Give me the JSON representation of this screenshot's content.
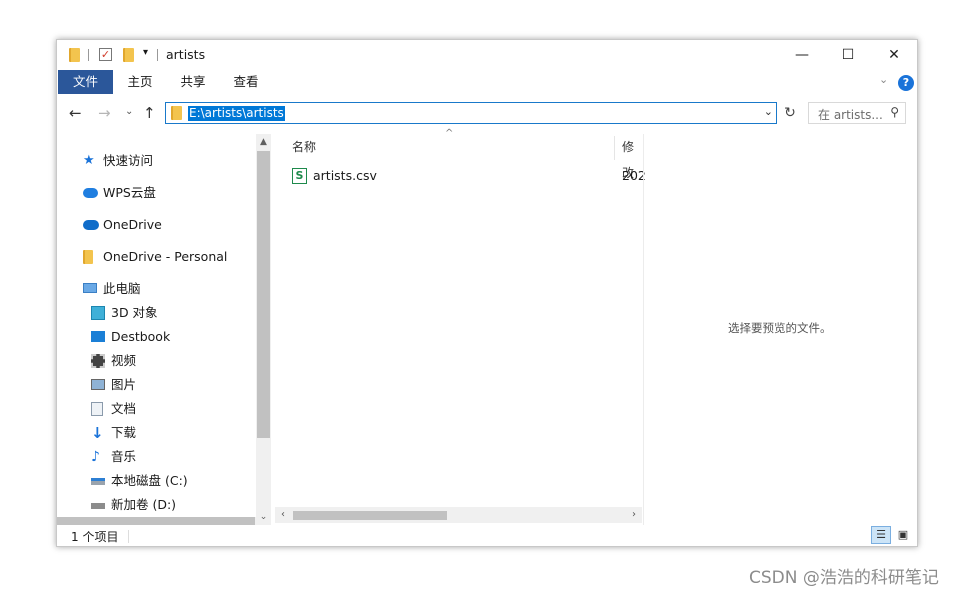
{
  "window": {
    "title": "artists",
    "controls": {
      "minimize": "—",
      "maximize": "☐",
      "close": "✕"
    }
  },
  "ribbon": {
    "tabs": [
      "文件",
      "主页",
      "共享",
      "查看"
    ],
    "help": "?"
  },
  "address": {
    "path": "E:\\artists\\artists",
    "search_placeholder": "在 artists..."
  },
  "navigation": {
    "items": [
      {
        "label": "快速访问",
        "icon": "star-icon",
        "indent": 0
      },
      {
        "label": "WPS云盘",
        "icon": "wps-cloud-icon",
        "indent": 0
      },
      {
        "label": "OneDrive",
        "icon": "onedrive-cloud-icon",
        "indent": 0
      },
      {
        "label": "OneDrive - Personal",
        "icon": "folder-icon",
        "indent": 0
      },
      {
        "label": "此电脑",
        "icon": "computer-icon",
        "indent": 0
      },
      {
        "label": "3D 对象",
        "icon": "3d-objects-icon",
        "indent": 1
      },
      {
        "label": "Destbook",
        "icon": "desktop-icon",
        "indent": 1
      },
      {
        "label": "视频",
        "icon": "video-icon",
        "indent": 1
      },
      {
        "label": "图片",
        "icon": "pictures-icon",
        "indent": 1
      },
      {
        "label": "文档",
        "icon": "documents-icon",
        "indent": 1
      },
      {
        "label": "下载",
        "icon": "download-icon",
        "indent": 1
      },
      {
        "label": "音乐",
        "icon": "music-icon",
        "indent": 1
      },
      {
        "label": "本地磁盘 (C:)",
        "icon": "local-disk-icon",
        "indent": 1
      },
      {
        "label": "新加卷 (D:)",
        "icon": "drive-icon",
        "indent": 1
      }
    ]
  },
  "files": {
    "columns": [
      "名称",
      "修改"
    ],
    "rows": [
      {
        "name": "artists.csv",
        "modified": "202",
        "icon": "wps-spreadsheet-icon"
      }
    ]
  },
  "preview": {
    "message": "选择要预览的文件。"
  },
  "status": {
    "count": "1 个项目"
  },
  "watermark": "CSDN @浩浩的科研笔记"
}
